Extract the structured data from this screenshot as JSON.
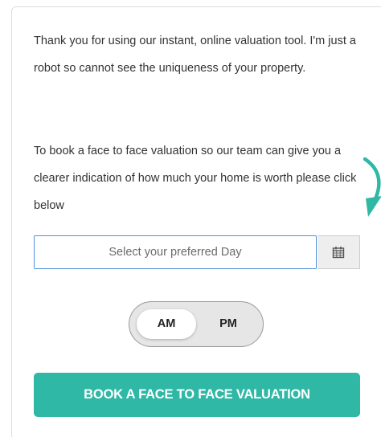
{
  "intro": {
    "paragraph1": "Thank you for using our instant, online valuation tool. I'm just a robot so cannot see the uniqueness of your property.",
    "paragraph2": "To book a face to face valuation so our team can give you a clearer indication of how much your home is worth please click below"
  },
  "day_picker": {
    "placeholder": "Select your preferred Day",
    "value": "",
    "calendar_icon": "calendar-icon"
  },
  "time_toggle": {
    "selected": "AM",
    "options": [
      "AM",
      "PM"
    ]
  },
  "cta": {
    "label": "BOOK A FACE TO FACE VALUATION"
  },
  "arrow_icon": "curved-arrow-icon",
  "colors": {
    "accent": "#2fb8a6",
    "input_border": "#4f8fe0",
    "toggle_bg": "#e6e6e6",
    "text": "#333333"
  }
}
